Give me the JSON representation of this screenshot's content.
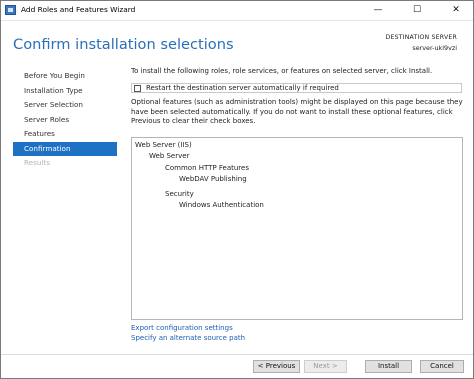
{
  "window": {
    "title": "Add Roles and Features Wizard",
    "minimize": "—",
    "maximize": "☐",
    "close": "✕"
  },
  "header": {
    "title": "Confirm installation selections",
    "destination_label": "DESTINATION SERVER",
    "destination_server": "server-ukl9vzi"
  },
  "nav": {
    "items": [
      {
        "label": "Before You Begin"
      },
      {
        "label": "Installation Type"
      },
      {
        "label": "Server Selection"
      },
      {
        "label": "Server Roles"
      },
      {
        "label": "Features"
      },
      {
        "label": "Confirmation"
      },
      {
        "label": "Results"
      }
    ]
  },
  "content": {
    "intro": "To install the following roles, role services, or features on selected server, click Install.",
    "restart_label": "Restart the destination server automatically if required",
    "restart_checked": false,
    "optional_text": "Optional features (such as administration tools) might be displayed on this page because they have been selected automatically. If you do not want to install these optional features, click Previous to clear their check boxes.",
    "features": [
      {
        "label": "Web Server (IIS)"
      },
      {
        "label": "Web Server"
      },
      {
        "label": "Common HTTP Features"
      },
      {
        "label": "WebDAV Publishing"
      },
      {
        "label": "Security"
      },
      {
        "label": "Windows Authentication"
      }
    ],
    "links": {
      "export": "Export configuration settings",
      "alternate_source": "Specify an alternate source path"
    }
  },
  "footer": {
    "previous": "< Previous",
    "next": "Next >",
    "install": "Install",
    "cancel": "Cancel"
  },
  "colors": {
    "accent": "#1e72c4",
    "title": "#2b6fb8",
    "link": "#1c5fb0"
  }
}
